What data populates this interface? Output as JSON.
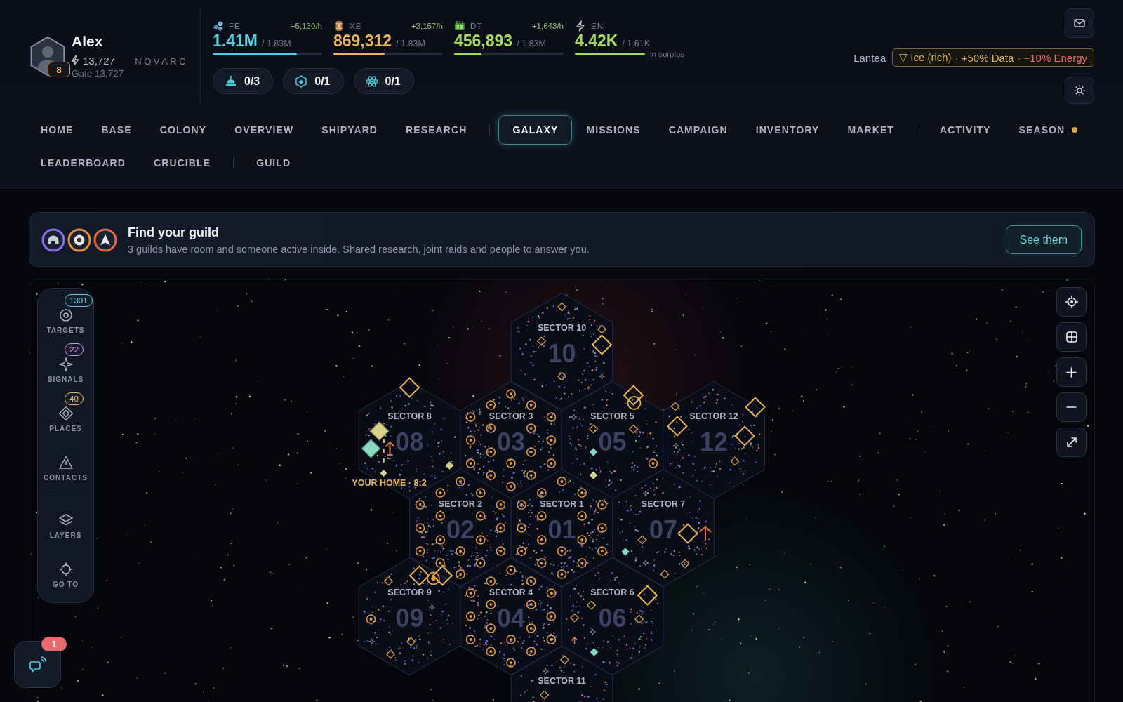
{
  "player": {
    "name": "Alex",
    "level": "8",
    "power": "13,727",
    "gate": "Gate 13,727",
    "faction": "NOVARC"
  },
  "resources": [
    {
      "kind": "ore",
      "code": "FE",
      "rate": "+5,130/h",
      "value": "1.41M",
      "capacity": "/ 1.83M",
      "level": 0.77,
      "color": "#5ccbe0"
    },
    {
      "kind": "barrel",
      "code": "XE",
      "rate": "+3,157/h",
      "value": "869,312",
      "capacity": "/ 1.83M",
      "level": 0.47,
      "color": "#e6b25c"
    },
    {
      "kind": "chip",
      "code": "DT",
      "rate": "+1,643/h",
      "value": "456,893",
      "capacity": "/ 1.83M",
      "level": 0.25,
      "color": "#a6d85e"
    },
    {
      "kind": "bolt",
      "code": "EN",
      "value": "4.42K",
      "capacity": "/ 1.61K",
      "level": 1,
      "color": "#a6d85e",
      "note": "in surplus"
    }
  ],
  "slots": [
    {
      "kind": "dome",
      "count": "0/3"
    },
    {
      "kind": "hexbadge",
      "count": "0/1"
    },
    {
      "kind": "atom",
      "count": "0/1"
    }
  ],
  "planet": {
    "name": "Lantea",
    "traits": [
      {
        "text": "▽ Ice (rich)",
        "negative": false
      },
      {
        "text": "· +50% Data",
        "negative": false
      },
      {
        "text": "· −10% Energy",
        "negative": true
      }
    ]
  },
  "nav": [
    [
      {
        "label": "HOME",
        "selected": false,
        "divider_before": false,
        "alert": false
      },
      {
        "label": "BASE",
        "selected": false,
        "divider_before": false,
        "alert": false
      },
      {
        "label": "COLONY",
        "selected": false,
        "divider_before": false,
        "alert": false
      },
      {
        "label": "OVERVIEW",
        "selected": false,
        "divider_before": false,
        "alert": false
      },
      {
        "label": "SHIPYARD",
        "selected": false,
        "divider_before": false,
        "alert": false
      },
      {
        "label": "RESEARCH",
        "selected": false,
        "divider_before": false,
        "alert": false
      },
      {
        "label": "GALAXY",
        "selected": true,
        "divider_before": true,
        "alert": false
      },
      {
        "label": "MISSIONS",
        "selected": false,
        "divider_before": false,
        "alert": false
      },
      {
        "label": "CAMPAIGN",
        "selected": false,
        "divider_before": false,
        "alert": false
      },
      {
        "label": "INVENTORY",
        "selected": false,
        "divider_before": false,
        "alert": false
      },
      {
        "label": "MARKET",
        "selected": false,
        "divider_before": false,
        "alert": false
      },
      {
        "label": "ACTIVITY",
        "selected": false,
        "divider_before": true,
        "alert": false
      },
      {
        "label": "SEASON",
        "selected": false,
        "divider_before": false,
        "alert": true
      }
    ],
    [
      {
        "label": "LEADERBOARD",
        "selected": false,
        "divider_before": false,
        "alert": false
      },
      {
        "label": "CRUCIBLE",
        "selected": false,
        "divider_before": false,
        "alert": false
      },
      {
        "label": "GUILD",
        "selected": false,
        "divider_before": true,
        "alert": false
      }
    ]
  ],
  "banner": {
    "guilds": [
      {
        "kind": "helmet",
        "color": "#8b6cf2"
      },
      {
        "kind": "orb",
        "color": "#e08c3c"
      },
      {
        "kind": "arrow",
        "color": "#e4683c"
      }
    ],
    "title": "Find your guild",
    "text": "3 guilds have room and someone active inside. Shared research, joint raids and people to answer you.",
    "button": "See them"
  },
  "map_tools": [
    {
      "kind": "targets",
      "label": "TARGETS",
      "count": "1301",
      "color": "#5fcfd8",
      "divider_before": false
    },
    {
      "kind": "signals",
      "label": "SIGNALS",
      "count": "22",
      "color": "#d88ae6",
      "divider_before": false
    },
    {
      "kind": "places",
      "label": "PLACES",
      "count": "40",
      "color": "#e6b65e",
      "divider_before": false
    },
    {
      "kind": "contacts",
      "label": "CONTACTS",
      "divider_before": false
    },
    {
      "kind": "layers",
      "label": "LAYERS",
      "divider_before": true
    },
    {
      "kind": "goto",
      "label": "GO TO",
      "divider_before": false
    }
  ],
  "sectors": [
    {
      "label": "SECTOR 10",
      "number": "10"
    },
    {
      "label": "SECTOR 8",
      "number": "08",
      "home_label": "YOUR HOME · 8:2"
    },
    {
      "label": "SECTOR 3",
      "number": "03"
    },
    {
      "label": "SECTOR 5",
      "number": "05"
    },
    {
      "label": "SECTOR 12",
      "number": "12"
    },
    {
      "label": "SECTOR 2",
      "number": "02"
    },
    {
      "label": "SECTOR 1",
      "number": "01"
    },
    {
      "label": "SECTOR 7",
      "number": "07"
    },
    {
      "label": "SECTOR 9",
      "number": "09"
    },
    {
      "label": "SECTOR 4",
      "number": "04"
    },
    {
      "label": "SECTOR 6",
      "number": "06"
    },
    {
      "label": "SECTOR 11"
    }
  ],
  "chat": {
    "badge": "1"
  }
}
